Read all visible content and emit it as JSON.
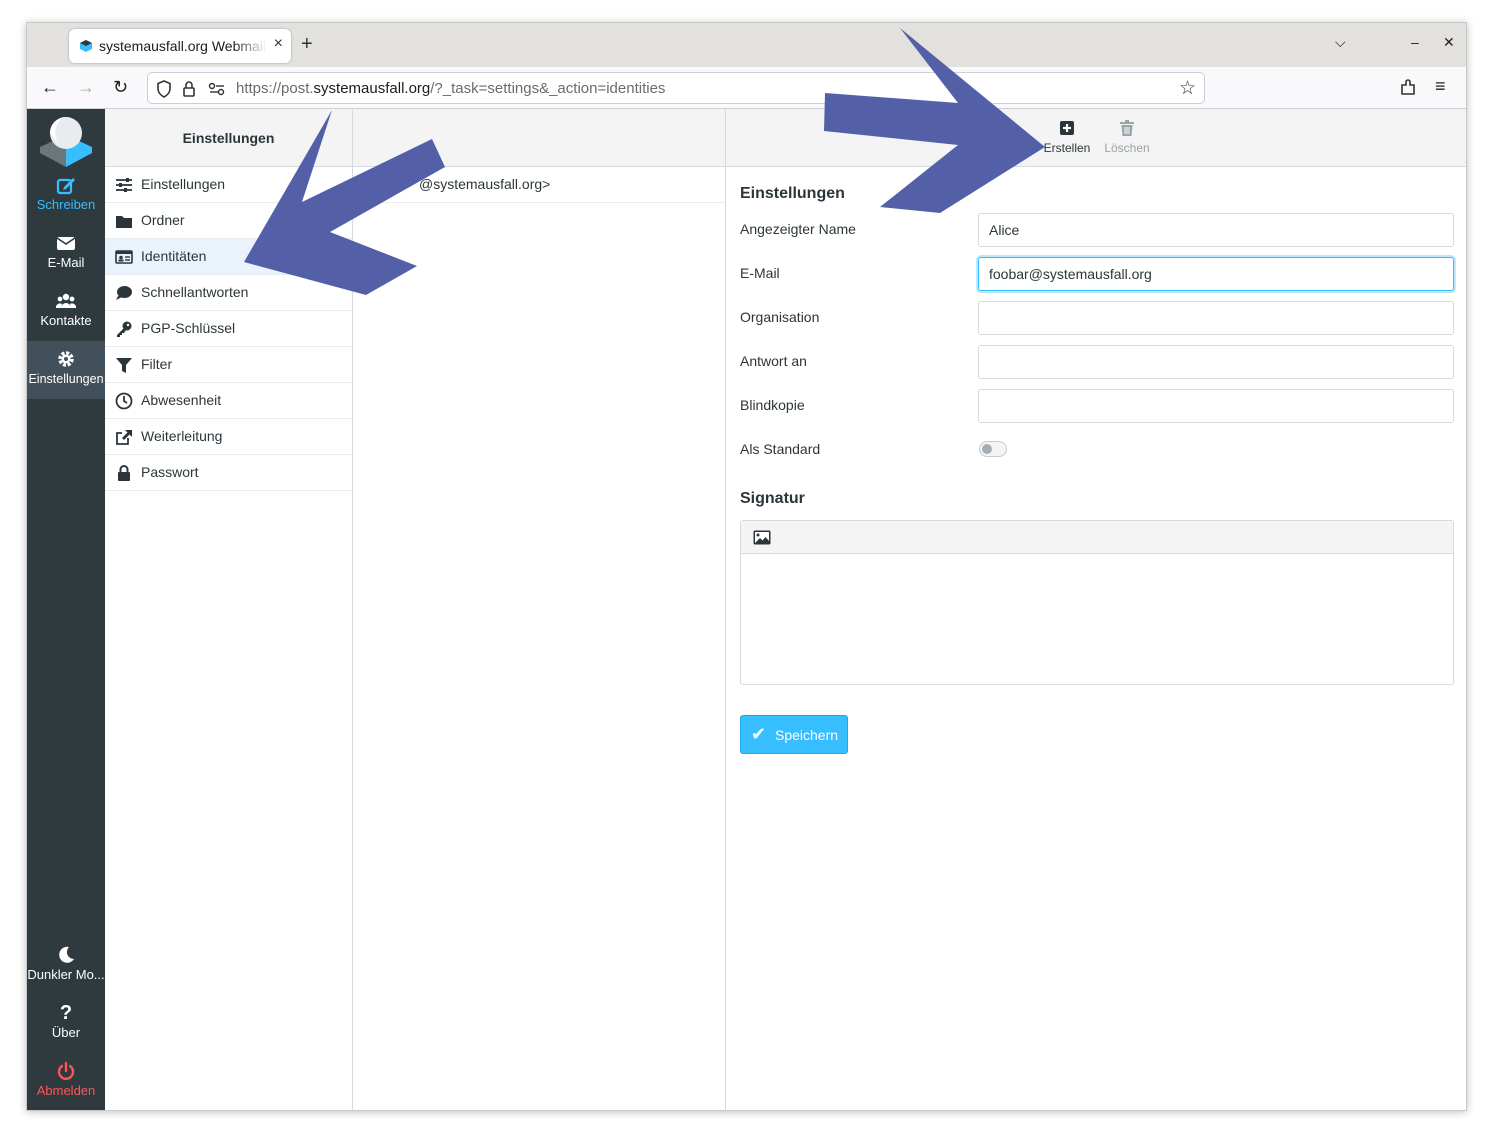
{
  "browser": {
    "tab_title": "systemausfall.org Webmail",
    "tab_close": "×",
    "new_tab": "+",
    "url_prefix": "https://post.",
    "url_domain": "systemausfall.org",
    "url_path": "/?_task=settings&_action=identities",
    "controls": {
      "list_tabs": "⌵",
      "minimize": "–",
      "close": "✕"
    }
  },
  "leftnav": {
    "items": [
      {
        "label": "Schreiben",
        "icon": "compose-icon"
      },
      {
        "label": "E-Mail",
        "icon": "envelope-icon"
      },
      {
        "label": "Kontakte",
        "icon": "users-icon"
      },
      {
        "label": "Einstellungen",
        "icon": "gear-icon"
      }
    ],
    "bottom": [
      {
        "label": "Dunkler Mo...",
        "icon": "moon-icon"
      },
      {
        "label": "Über",
        "icon": "question-icon"
      },
      {
        "label": "Abmelden",
        "icon": "power-icon"
      }
    ]
  },
  "settings": {
    "title": "Einstellungen",
    "menu": [
      {
        "label": "Einstellungen",
        "icon": "sliders-icon"
      },
      {
        "label": "Ordner",
        "icon": "folder-icon"
      },
      {
        "label": "Identitäten",
        "icon": "id-card-icon"
      },
      {
        "label": "Schnellantworten",
        "icon": "comment-icon"
      },
      {
        "label": "PGP-Schlüssel",
        "icon": "key-icon"
      },
      {
        "label": "Filter",
        "icon": "filter-icon"
      },
      {
        "label": "Abwesenheit",
        "icon": "clock-icon"
      },
      {
        "label": "Weiterleitung",
        "icon": "share-icon"
      },
      {
        "label": "Passwort",
        "icon": "lock-icon"
      }
    ]
  },
  "identities": {
    "row": "@systemausfall.org>"
  },
  "toolbar": {
    "create": "Erstellen",
    "delete": "Löschen"
  },
  "form": {
    "section_title": "Einstellungen",
    "display_name_label": "Angezeigter Name",
    "display_name_value": "Alice",
    "email_label": "E-Mail",
    "email_value": "foobar@systemausfall.org",
    "organization_label": "Organisation",
    "organization_value": "",
    "reply_to_label": "Antwort an",
    "reply_to_value": "",
    "bcc_label": "Blindkopie",
    "bcc_value": "",
    "standard_label": "Als Standard",
    "standard_on": false,
    "signature_title": "Signatur",
    "save_label": "Speichern"
  },
  "colors": {
    "accent": "#37beff",
    "sidebar": "#2f3a3f",
    "annotation_arrow": "#5360a8",
    "logout": "#ff5552"
  }
}
